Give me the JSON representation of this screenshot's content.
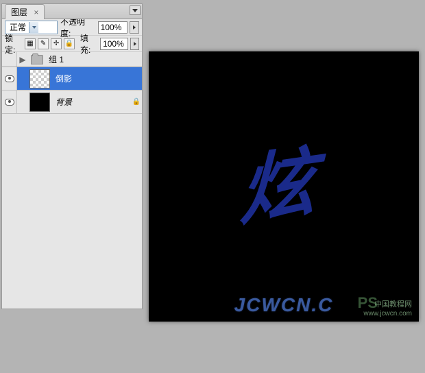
{
  "panel": {
    "tab": "图层",
    "tab_close": "×",
    "blend_mode": "正常",
    "opacity_label": "不透明度:",
    "opacity_value": "100%",
    "lock_label": "锁定:",
    "fill_label": "填充:",
    "fill_value": "100%",
    "group_label": "组 1"
  },
  "layers": [
    {
      "name": "倒影",
      "selected": true,
      "thumb": "checker",
      "locked": false
    },
    {
      "name": "背景",
      "selected": false,
      "thumb": "black",
      "locked": true
    }
  ],
  "canvas": {
    "glyph": "炫",
    "footer": "JCWCN.C",
    "watermark_ps": "PS",
    "watermark_cn": "中国教程网",
    "watermark_sub": "www.jcwcn.com"
  },
  "lock_icons": [
    "▦",
    "✎",
    "✢",
    "🔒"
  ]
}
